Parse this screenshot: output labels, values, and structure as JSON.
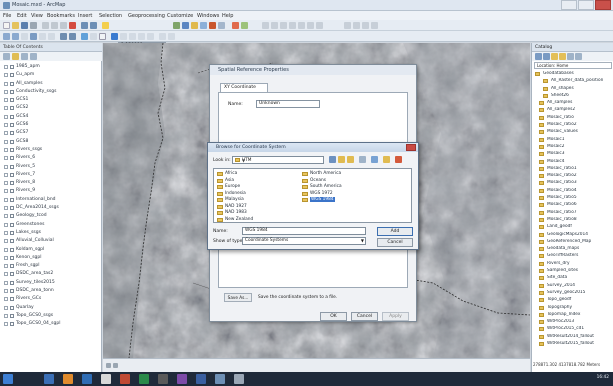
{
  "window": {
    "title": "Mosaic.mxd - ArcMap",
    "menu": [
      "File",
      "Edit",
      "View",
      "Bookmarks",
      "Insert",
      "Selection",
      "Geoprocessing",
      "Customize",
      "Windows",
      "Help"
    ],
    "scale": "1:150000"
  },
  "toc": {
    "title": "Table Of Contents",
    "layers": [
      "1985_apm",
      "Cu_apm",
      "All_samples",
      "Conductivity_ssgs",
      "GCS1",
      "GCS2",
      "GCS4",
      "GCS6",
      "GCS7",
      "GCS8",
      "Rivers_ssgs",
      "Rivers_6",
      "Rivers_5",
      "Rivers_7",
      "Rivers_8",
      "Rivers_9",
      "International_bnd",
      "DC_Area2014_ssgs",
      "Geology_tcod",
      "Greenstones",
      "Lakes_ssgs",
      "Alluvial_Colluvial",
      "Koldam_sgpl",
      "Kenon_sgpl",
      "Fresh_sgpl",
      "DSDC_area_tas2",
      "Survey_tiles2015",
      "DSDC_area_tonn",
      "Rivers_GCs",
      "Quarlay",
      "Topo_GCS0_ssgs",
      "Topo_GCS0_04_sgpl"
    ]
  },
  "catalog": {
    "title": "Catalog",
    "location": "Location: Home",
    "items": [
      "Geodatabases",
      "All_Raster_data_position",
      "All_shapes",
      "Sheet26",
      "All_samples",
      "All_samples2",
      "Mosaic_ratio",
      "Mosaic_ratio2",
      "Mosaic_values",
      "Mosaic1",
      "Mosaic2",
      "Mosaic3",
      "Mosaic4",
      "Mosaic_ratio1",
      "Mosaic_ratio2",
      "Mosaic_ratio3",
      "Mosaic_ratio4",
      "Mosaic_ratio5",
      "Mosaic_ratio6",
      "Mosaic_ratio7",
      "Mosaic_ratio8",
      "Land_geodf",
      "GeologicMaps2014",
      "GeoReferenced_Map",
      "Geodata_maps",
      "GeoTiffRasters",
      "Rivers_dry",
      "Sampled_sites",
      "Site_data",
      "Survey_2014",
      "Survey_geoc2015",
      "Topo_geodf",
      "Topography",
      "Topomap_Index",
      "WitProc2013",
      "WitProc2015_cd1",
      "WitResult2014_fallout",
      "WitResult2015_fallout"
    ],
    "status": "278871.302  4137818.782 Meters"
  },
  "spatial_dialog": {
    "title": "Spatial Reference Properties",
    "tab": "XY Coordinate System",
    "name_label": "Name:",
    "name_value": "Unknown",
    "save_as": "Save As...",
    "save_desc": "Save the coordinate system to a file.",
    "ok": "OK",
    "cancel": "Cancel",
    "apply": "Apply"
  },
  "browse_dialog": {
    "title": "Browse for Coordinate System",
    "look_in_label": "Look in:",
    "look_in": "UTM",
    "folders_col1": [
      "Africa",
      "Asia",
      "Europe",
      "Indonesia",
      "Malaysia",
      "NAD 1927",
      "NAD 1983",
      "New Zealand"
    ],
    "folders_col2": [
      "North America",
      "Oceans",
      "South America",
      "WGS 1972",
      "WGS 1984"
    ],
    "selected": "WGS 1984",
    "name_label": "Name:",
    "name_value": "WGS 1984",
    "type_label": "Show of type:",
    "type_value": "Coordinate Systems",
    "add": "Add",
    "cancel": "Cancel"
  },
  "taskbar": {
    "clock": "16:42"
  }
}
